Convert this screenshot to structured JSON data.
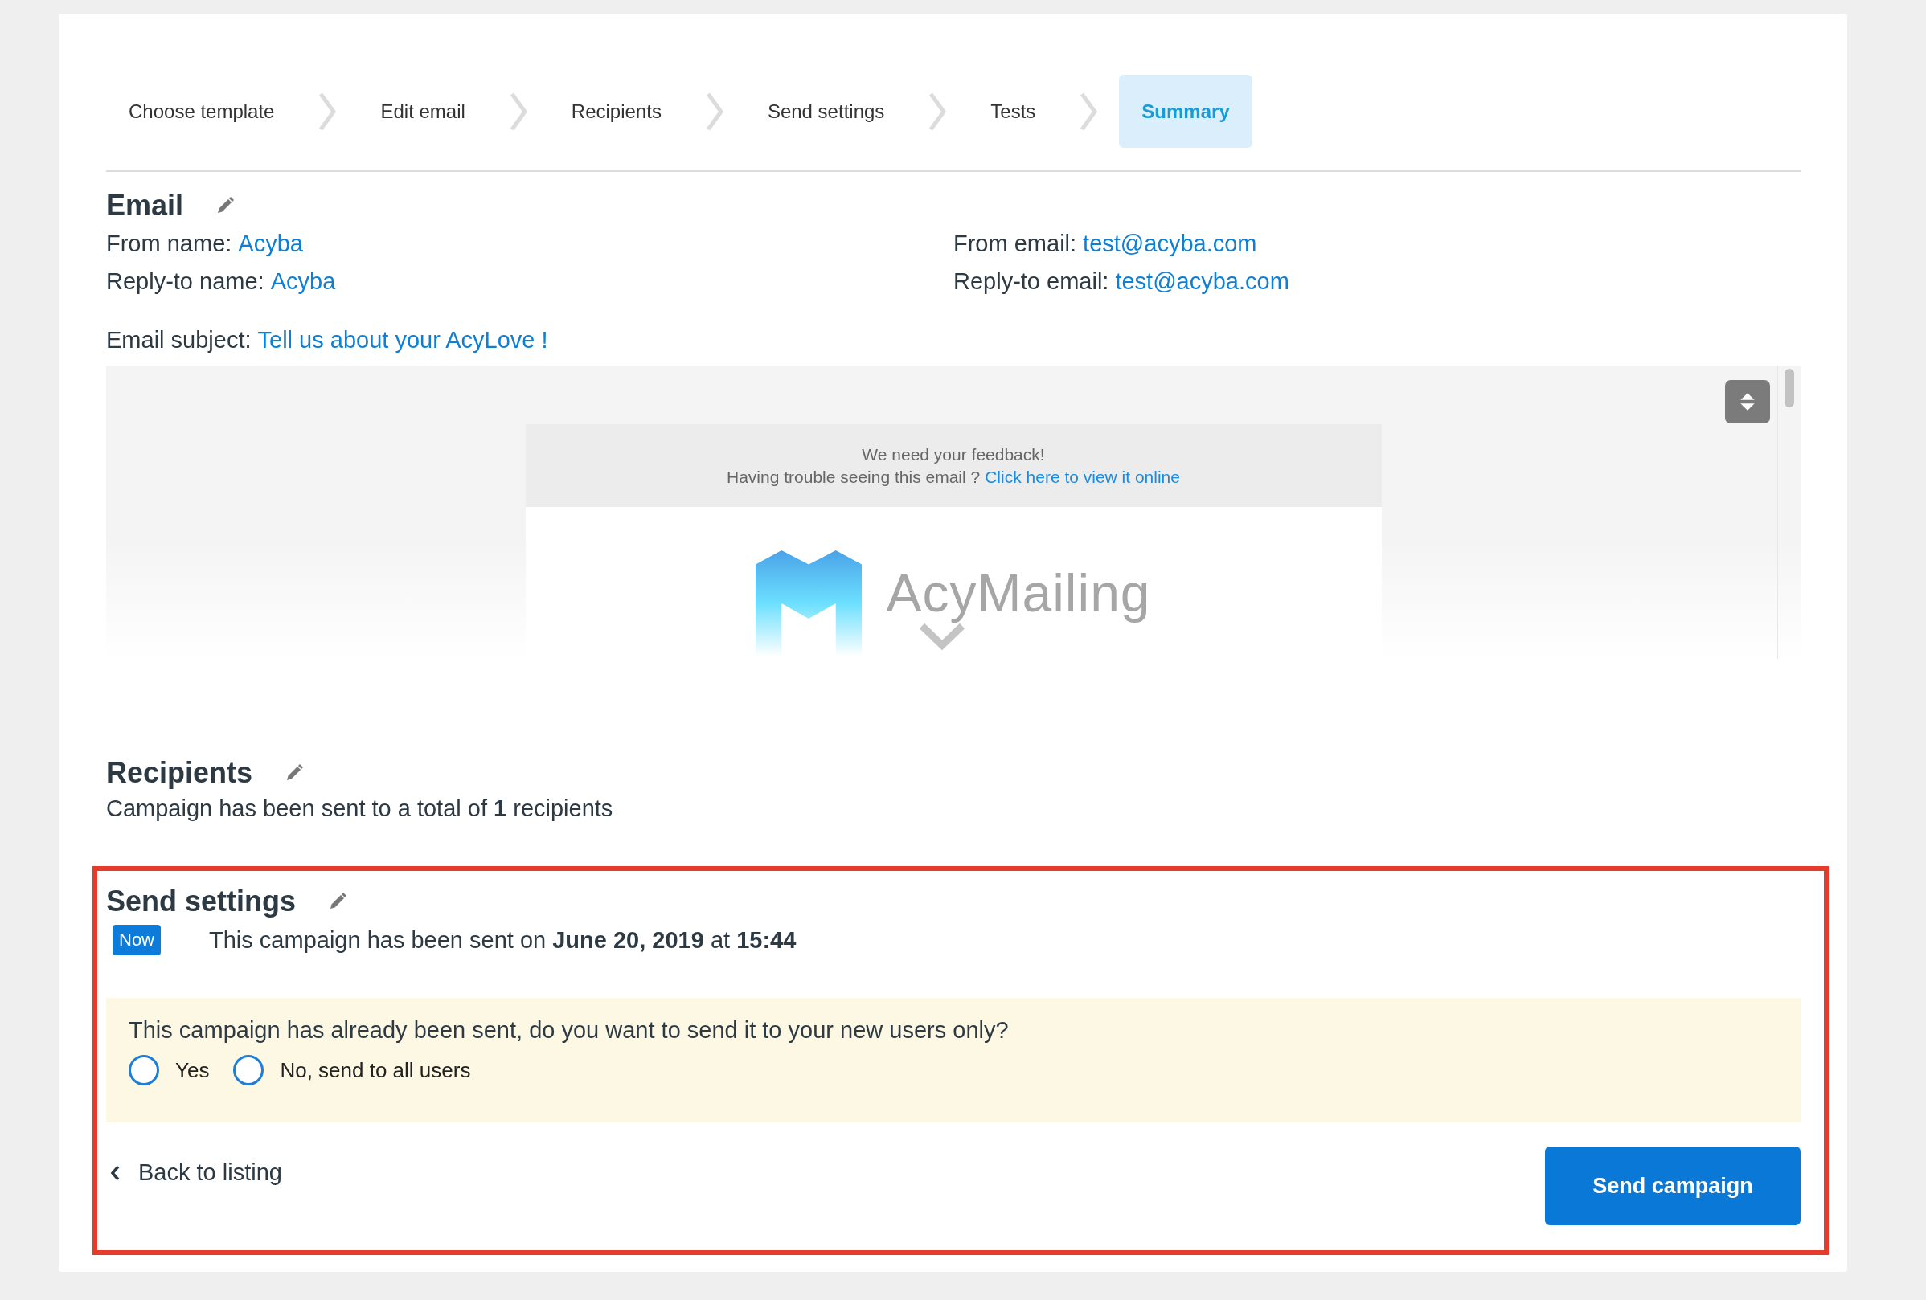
{
  "steps": [
    {
      "label": "Choose template",
      "selected": false
    },
    {
      "label": "Edit email",
      "selected": false
    },
    {
      "label": "Recipients",
      "selected": false
    },
    {
      "label": "Send settings",
      "selected": false
    },
    {
      "label": "Tests",
      "selected": false
    },
    {
      "label": "Summary",
      "selected": true
    }
  ],
  "email": {
    "title": "Email",
    "fields": [
      {
        "label": "From name:",
        "value": "Acyba"
      },
      {
        "label": "From email:",
        "value": "test@acyba.com"
      },
      {
        "label": "Reply-to name:",
        "value": "Acyba"
      },
      {
        "label": "Reply-to email:",
        "value": "test@acyba.com"
      }
    ],
    "subject": {
      "label": "Email subject:",
      "value": "Tell us about your AcyLove !"
    },
    "preview": {
      "header_line": "We need your feedback!",
      "trouble_text": "Having trouble seeing this email ?",
      "view_link": "Click here to view it online",
      "logo_text": "AcyMailing"
    }
  },
  "recipients": {
    "title": "Recipients",
    "summary": "Campaign has been sent to a total of **1** recipients"
  },
  "send_settings": {
    "title": "Send settings",
    "badge": "Now",
    "sent_text": "This campaign has been sent on **June 20, 2019** at **15:44**",
    "question": "This campaign has already been sent, do you want to send it to your new users only?",
    "options": [
      {
        "label": "Yes",
        "selected": false
      },
      {
        "label": "No, send to all users",
        "selected": false
      }
    ],
    "back_link": "Back to listing",
    "send_button": "Send campaign"
  }
}
